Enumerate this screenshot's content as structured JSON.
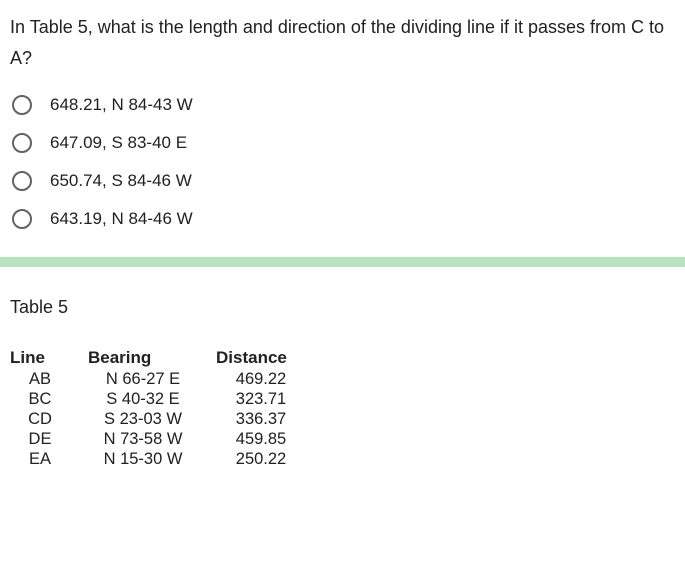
{
  "question": "In Table 5, what is the length and direction of the dividing line if it passes from C to A?",
  "options": [
    "648.21, N 84-43 W",
    "647.09, S 83-40 E",
    "650.74, S 84-46 W",
    "643.19, N 84-46 W"
  ],
  "table": {
    "title": "Table 5",
    "headers": [
      "Line",
      "Bearing",
      "Distance"
    ],
    "rows": [
      {
        "line": "AB",
        "bearing": "N 66-27 E",
        "distance": "469.22"
      },
      {
        "line": "BC",
        "bearing": "S 40-32 E",
        "distance": "323.71"
      },
      {
        "line": "CD",
        "bearing": "S 23-03 W",
        "distance": "336.37"
      },
      {
        "line": "DE",
        "bearing": "N 73-58 W",
        "distance": "459.85"
      },
      {
        "line": "EA",
        "bearing": "N 15-30 W",
        "distance": "250.22"
      }
    ]
  }
}
